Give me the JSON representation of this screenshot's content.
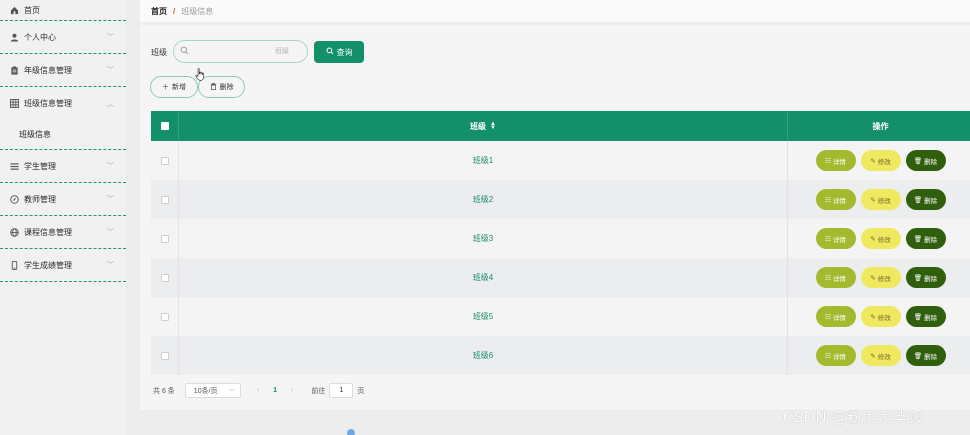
{
  "sidebar": {
    "items": [
      {
        "label": "首页",
        "icon": "home-icon"
      },
      {
        "label": "个人中心",
        "icon": "user-icon"
      },
      {
        "label": "年级信息管理",
        "icon": "clipboard-icon"
      },
      {
        "label": "班级信息管理",
        "icon": "grid-icon",
        "sub": "班级信息"
      },
      {
        "label": "学生管理",
        "icon": "list-icon"
      },
      {
        "label": "教师管理",
        "icon": "compass-icon"
      },
      {
        "label": "课程信息管理",
        "icon": "globe-icon"
      },
      {
        "label": "学生成绩管理",
        "icon": "phone-icon"
      }
    ]
  },
  "breadcrumb": {
    "home": "首页",
    "separator": "/",
    "current": "班级信息"
  },
  "search": {
    "label": "班级",
    "placeholder": "班级",
    "value": "",
    "button": "查询"
  },
  "actions": {
    "add": "新增",
    "delete": "删除"
  },
  "table": {
    "columns": {
      "name": "班级",
      "operations": "操作"
    },
    "rows": [
      {
        "name": "班级1"
      },
      {
        "name": "班级2"
      },
      {
        "name": "班级3"
      },
      {
        "name": "班级4"
      },
      {
        "name": "班级5"
      },
      {
        "name": "班级6"
      }
    ],
    "row_actions": {
      "detail": "详情",
      "edit": "修改",
      "delete": "删除"
    }
  },
  "pagination": {
    "total": "共 6 条",
    "page_size": "10条/页",
    "current_page": "1",
    "goto_label": "前往",
    "goto_value": "1",
    "page_suffix": "页"
  },
  "watermark": "CSDN @粉泡泡毕设",
  "colors": {
    "primary": "#13906a",
    "detail": "#a3b92e",
    "edit": "#f0e85e",
    "delete": "#2f5e0d",
    "divider": "#1a9a6e"
  }
}
